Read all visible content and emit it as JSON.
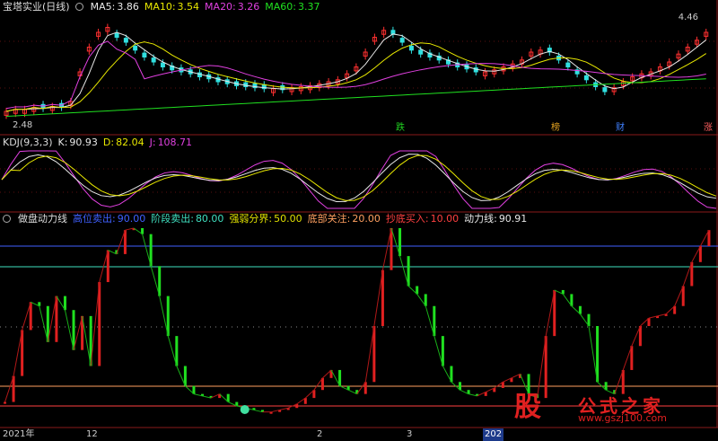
{
  "header": {
    "stock_title": "宝塔实业(日线)",
    "ma": [
      {
        "label": "MA5:",
        "value": "3.86",
        "color": "#e8e8e8"
      },
      {
        "label": "MA10:",
        "value": "3.54",
        "color": "#e8e800"
      },
      {
        "label": "MA20:",
        "value": "3.26",
        "color": "#e040e0"
      },
      {
        "label": "MA60:",
        "value": "3.37",
        "color": "#20e020"
      }
    ]
  },
  "price_labels": {
    "high": "4.46",
    "low": "2.48"
  },
  "events": [
    {
      "text": "跌",
      "color": "#20d020"
    },
    {
      "text": "榜",
      "color": "#e0a020"
    },
    {
      "text": "财",
      "color": "#4080ff"
    },
    {
      "text": "涨",
      "color": "#ff6060"
    }
  ],
  "kdj": {
    "title": "KDJ(9,3,3)",
    "items": [
      {
        "label": "K:",
        "value": "90.93",
        "color": "#e8e8e8"
      },
      {
        "label": "D:",
        "value": "82.04",
        "color": "#e8e800"
      },
      {
        "label": "J:",
        "value": "108.71",
        "color": "#e040e0"
      }
    ]
  },
  "indicator": {
    "title": "做盘动力线",
    "items": [
      {
        "label": "高位卖出:",
        "value": "90.00",
        "color": "#4060ff"
      },
      {
        "label": "阶段卖出:",
        "value": "80.00",
        "color": "#40e0c0"
      },
      {
        "label": "强弱分界:",
        "value": "50.00",
        "color": "#e0e000"
      },
      {
        "label": "底部关注:",
        "value": "20.00",
        "color": "#ffa060"
      },
      {
        "label": "抄底买入:",
        "value": "10.00",
        "color": "#ff4040"
      },
      {
        "label": "动力线:",
        "value": "90.91",
        "color": "#e8e8e8"
      }
    ]
  },
  "x_axis": [
    {
      "text": "2021年",
      "hl": false
    },
    {
      "text": "12",
      "hl": false
    },
    {
      "text": "2",
      "hl": false
    },
    {
      "text": "3",
      "hl": false
    },
    {
      "text": "202",
      "hl": true
    }
  ],
  "watermark": {
    "logo": "股",
    "title": "公式之家",
    "url": "www.gszj100.com"
  },
  "chart_data": {
    "type": "line",
    "kdj_levels": [],
    "indicator_levels": [
      90,
      80,
      50,
      20,
      10
    ],
    "indicator_line_last": 90.91,
    "price_range": [
      2.48,
      4.46
    ],
    "series": [
      {
        "name": "MA5",
        "last": 3.86
      },
      {
        "name": "MA10",
        "last": 3.54
      },
      {
        "name": "MA20",
        "last": 3.26
      },
      {
        "name": "MA60",
        "last": 3.37
      },
      {
        "name": "K",
        "last": 90.93
      },
      {
        "name": "D",
        "last": 82.04
      },
      {
        "name": "J",
        "last": 108.71
      }
    ],
    "indicator_values": [
      12,
      25,
      48,
      62,
      60,
      42,
      65,
      58,
      38,
      55,
      30,
      72,
      88,
      86,
      98,
      99,
      96,
      80,
      65,
      45,
      30,
      20,
      16,
      15,
      14,
      16,
      12,
      10,
      9,
      8,
      7,
      7,
      8,
      9,
      11,
      14,
      18,
      24,
      28,
      20,
      18,
      16,
      22,
      50,
      78,
      99,
      85,
      70,
      66,
      60,
      45,
      30,
      22,
      18,
      16,
      15,
      17,
      19,
      22,
      24,
      26,
      16,
      14,
      45,
      68,
      66,
      60,
      56,
      50,
      22,
      18,
      16,
      28,
      40,
      50,
      54,
      55,
      56,
      60,
      70,
      82,
      90,
      98
    ]
  }
}
